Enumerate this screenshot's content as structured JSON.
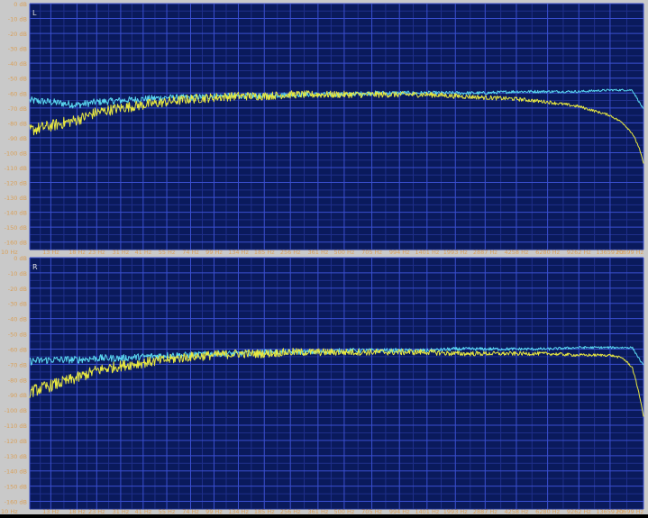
{
  "colors": {
    "frame": "#c9c9c9",
    "plot_bg": "#0a1a5c",
    "grid_major": "#3a4fd0",
    "grid_minor": "#1f2f8a",
    "tick_text": "#d8a05a",
    "channel_text": "#e0e0e0",
    "series_a": "#5ad8f0",
    "series_b": "#e8e840"
  },
  "chart_data": [
    {
      "type": "line",
      "channel_label": "L",
      "y_unit_suffix": " dB",
      "x_scale": "log",
      "xlim": [
        10,
        20699
      ],
      "ylim": [
        -165,
        0
      ],
      "grid": true,
      "y_ticks": [
        0,
        -10,
        -20,
        -30,
        -40,
        -50,
        -60,
        -70,
        -80,
        -90,
        -100,
        -110,
        -120,
        -130,
        -140,
        -150,
        -160
      ],
      "y_tick_labels": [
        "0 dB",
        "-10 dB",
        "-20 dB",
        "-30 dB",
        "-40 dB",
        "-50 dB",
        "-60 dB",
        "-70 dB",
        "-80 dB",
        "-90 dB",
        "-100 dB",
        "-110 dB",
        "-120 dB",
        "-130 dB",
        "-140 dB",
        "-150 dB",
        "-160 dB"
      ],
      "x_ticks": [
        10,
        13,
        18,
        23,
        31,
        41,
        55,
        74,
        99,
        134,
        185,
        256,
        361,
        500,
        705,
        994,
        1401,
        1993,
        2887,
        4258,
        6280,
        9262,
        13659,
        20699
      ],
      "x_tick_labels": [
        "10 Hz",
        "13 Hz",
        "18 Hz",
        "23 Hz",
        "31 Hz",
        "41 Hz",
        "55 Hz",
        "74 Hz",
        "99 Hz",
        "134 Hz",
        "185 Hz",
        "256 Hz",
        "361 Hz",
        "500 Hz",
        "705 Hz",
        "994 Hz",
        "1401 Hz",
        "1993 Hz",
        "2887 Hz",
        "4258 Hz",
        "6280 Hz",
        "9262 Hz",
        "13659 Hz",
        "20699 Hz"
      ],
      "series": [
        {
          "color": "#5ad8f0",
          "x": [
            10,
            13,
            18,
            23,
            31,
            41,
            55,
            74,
            99,
            134,
            185,
            256,
            361,
            500,
            705,
            994,
            1401,
            1993,
            2887,
            4258,
            6280,
            9262,
            13659,
            18000,
            20699
          ],
          "y": [
            -65,
            -66,
            -68,
            -66,
            -65,
            -64,
            -63,
            -63,
            -62,
            -62,
            -62,
            -61,
            -61,
            -61,
            -60,
            -60,
            -60,
            -60,
            -60,
            -59,
            -59,
            -59,
            -58,
            -58,
            -71
          ]
        },
        {
          "color": "#e8e840",
          "x": [
            10,
            13,
            18,
            23,
            31,
            41,
            55,
            74,
            99,
            134,
            185,
            256,
            361,
            500,
            705,
            994,
            1401,
            1993,
            2887,
            4258,
            6280,
            9262,
            13659,
            16000,
            18000,
            19500,
            20699
          ],
          "y": [
            -85,
            -82,
            -78,
            -73,
            -70,
            -68,
            -66,
            -64,
            -63,
            -62,
            -62,
            -61,
            -61,
            -61,
            -61,
            -61,
            -61,
            -62,
            -63,
            -64,
            -66,
            -69,
            -75,
            -80,
            -87,
            -96,
            -107
          ]
        }
      ]
    },
    {
      "type": "line",
      "channel_label": "R",
      "y_unit_suffix": " dB",
      "x_scale": "log",
      "xlim": [
        10,
        20699
      ],
      "ylim": [
        -165,
        0
      ],
      "grid": true,
      "y_ticks": [
        0,
        -10,
        -20,
        -30,
        -40,
        -50,
        -60,
        -70,
        -80,
        -90,
        -100,
        -110,
        -120,
        -130,
        -140,
        -150,
        -160
      ],
      "y_tick_labels": [
        "0 dB",
        "-10 dB",
        "-20 dB",
        "-30 dB",
        "-40 dB",
        "-50 dB",
        "-60 dB",
        "-70 dB",
        "-80 dB",
        "-90 dB",
        "-100 dB",
        "-110 dB",
        "-120 dB",
        "-130 dB",
        "-140 dB",
        "-150 dB",
        "-160 dB"
      ],
      "x_ticks": [
        10,
        13,
        18,
        23,
        31,
        41,
        55,
        74,
        99,
        134,
        185,
        256,
        361,
        500,
        705,
        994,
        1401,
        1993,
        2887,
        4258,
        6280,
        9262,
        13659,
        20699
      ],
      "x_tick_labels": [
        "10 Hz",
        "13 Hz",
        "18 Hz",
        "23 Hz",
        "31 Hz",
        "41 Hz",
        "55 Hz",
        "74 Hz",
        "99 Hz",
        "134 Hz",
        "185 Hz",
        "256 Hz",
        "361 Hz",
        "500 Hz",
        "705 Hz",
        "994 Hz",
        "1401 Hz",
        "1993 Hz",
        "2887 Hz",
        "4258 Hz",
        "6280 Hz",
        "9262 Hz",
        "13659 Hz",
        "20699 Hz"
      ],
      "series": [
        {
          "color": "#5ad8f0",
          "x": [
            10,
            13,
            18,
            23,
            31,
            41,
            55,
            74,
            99,
            134,
            185,
            256,
            361,
            500,
            705,
            994,
            1401,
            1993,
            2887,
            4258,
            6280,
            9262,
            13659,
            18000,
            20699
          ],
          "y": [
            -68,
            -67,
            -67,
            -66,
            -66,
            -65,
            -64,
            -64,
            -63,
            -63,
            -62,
            -62,
            -62,
            -61,
            -61,
            -61,
            -61,
            -60,
            -60,
            -60,
            -60,
            -59,
            -59,
            -59,
            -71
          ]
        },
        {
          "color": "#e8e840",
          "x": [
            10,
            13,
            18,
            23,
            31,
            41,
            55,
            74,
            99,
            134,
            185,
            256,
            361,
            500,
            705,
            994,
            1401,
            1993,
            2887,
            4258,
            6280,
            9262,
            13659,
            16000,
            18000,
            19500,
            20699
          ],
          "y": [
            -88,
            -84,
            -79,
            -74,
            -71,
            -69,
            -67,
            -65,
            -64,
            -63,
            -63,
            -62,
            -62,
            -62,
            -62,
            -62,
            -62,
            -63,
            -63,
            -63,
            -63,
            -64,
            -64,
            -66,
            -72,
            -88,
            -104
          ]
        }
      ]
    }
  ]
}
